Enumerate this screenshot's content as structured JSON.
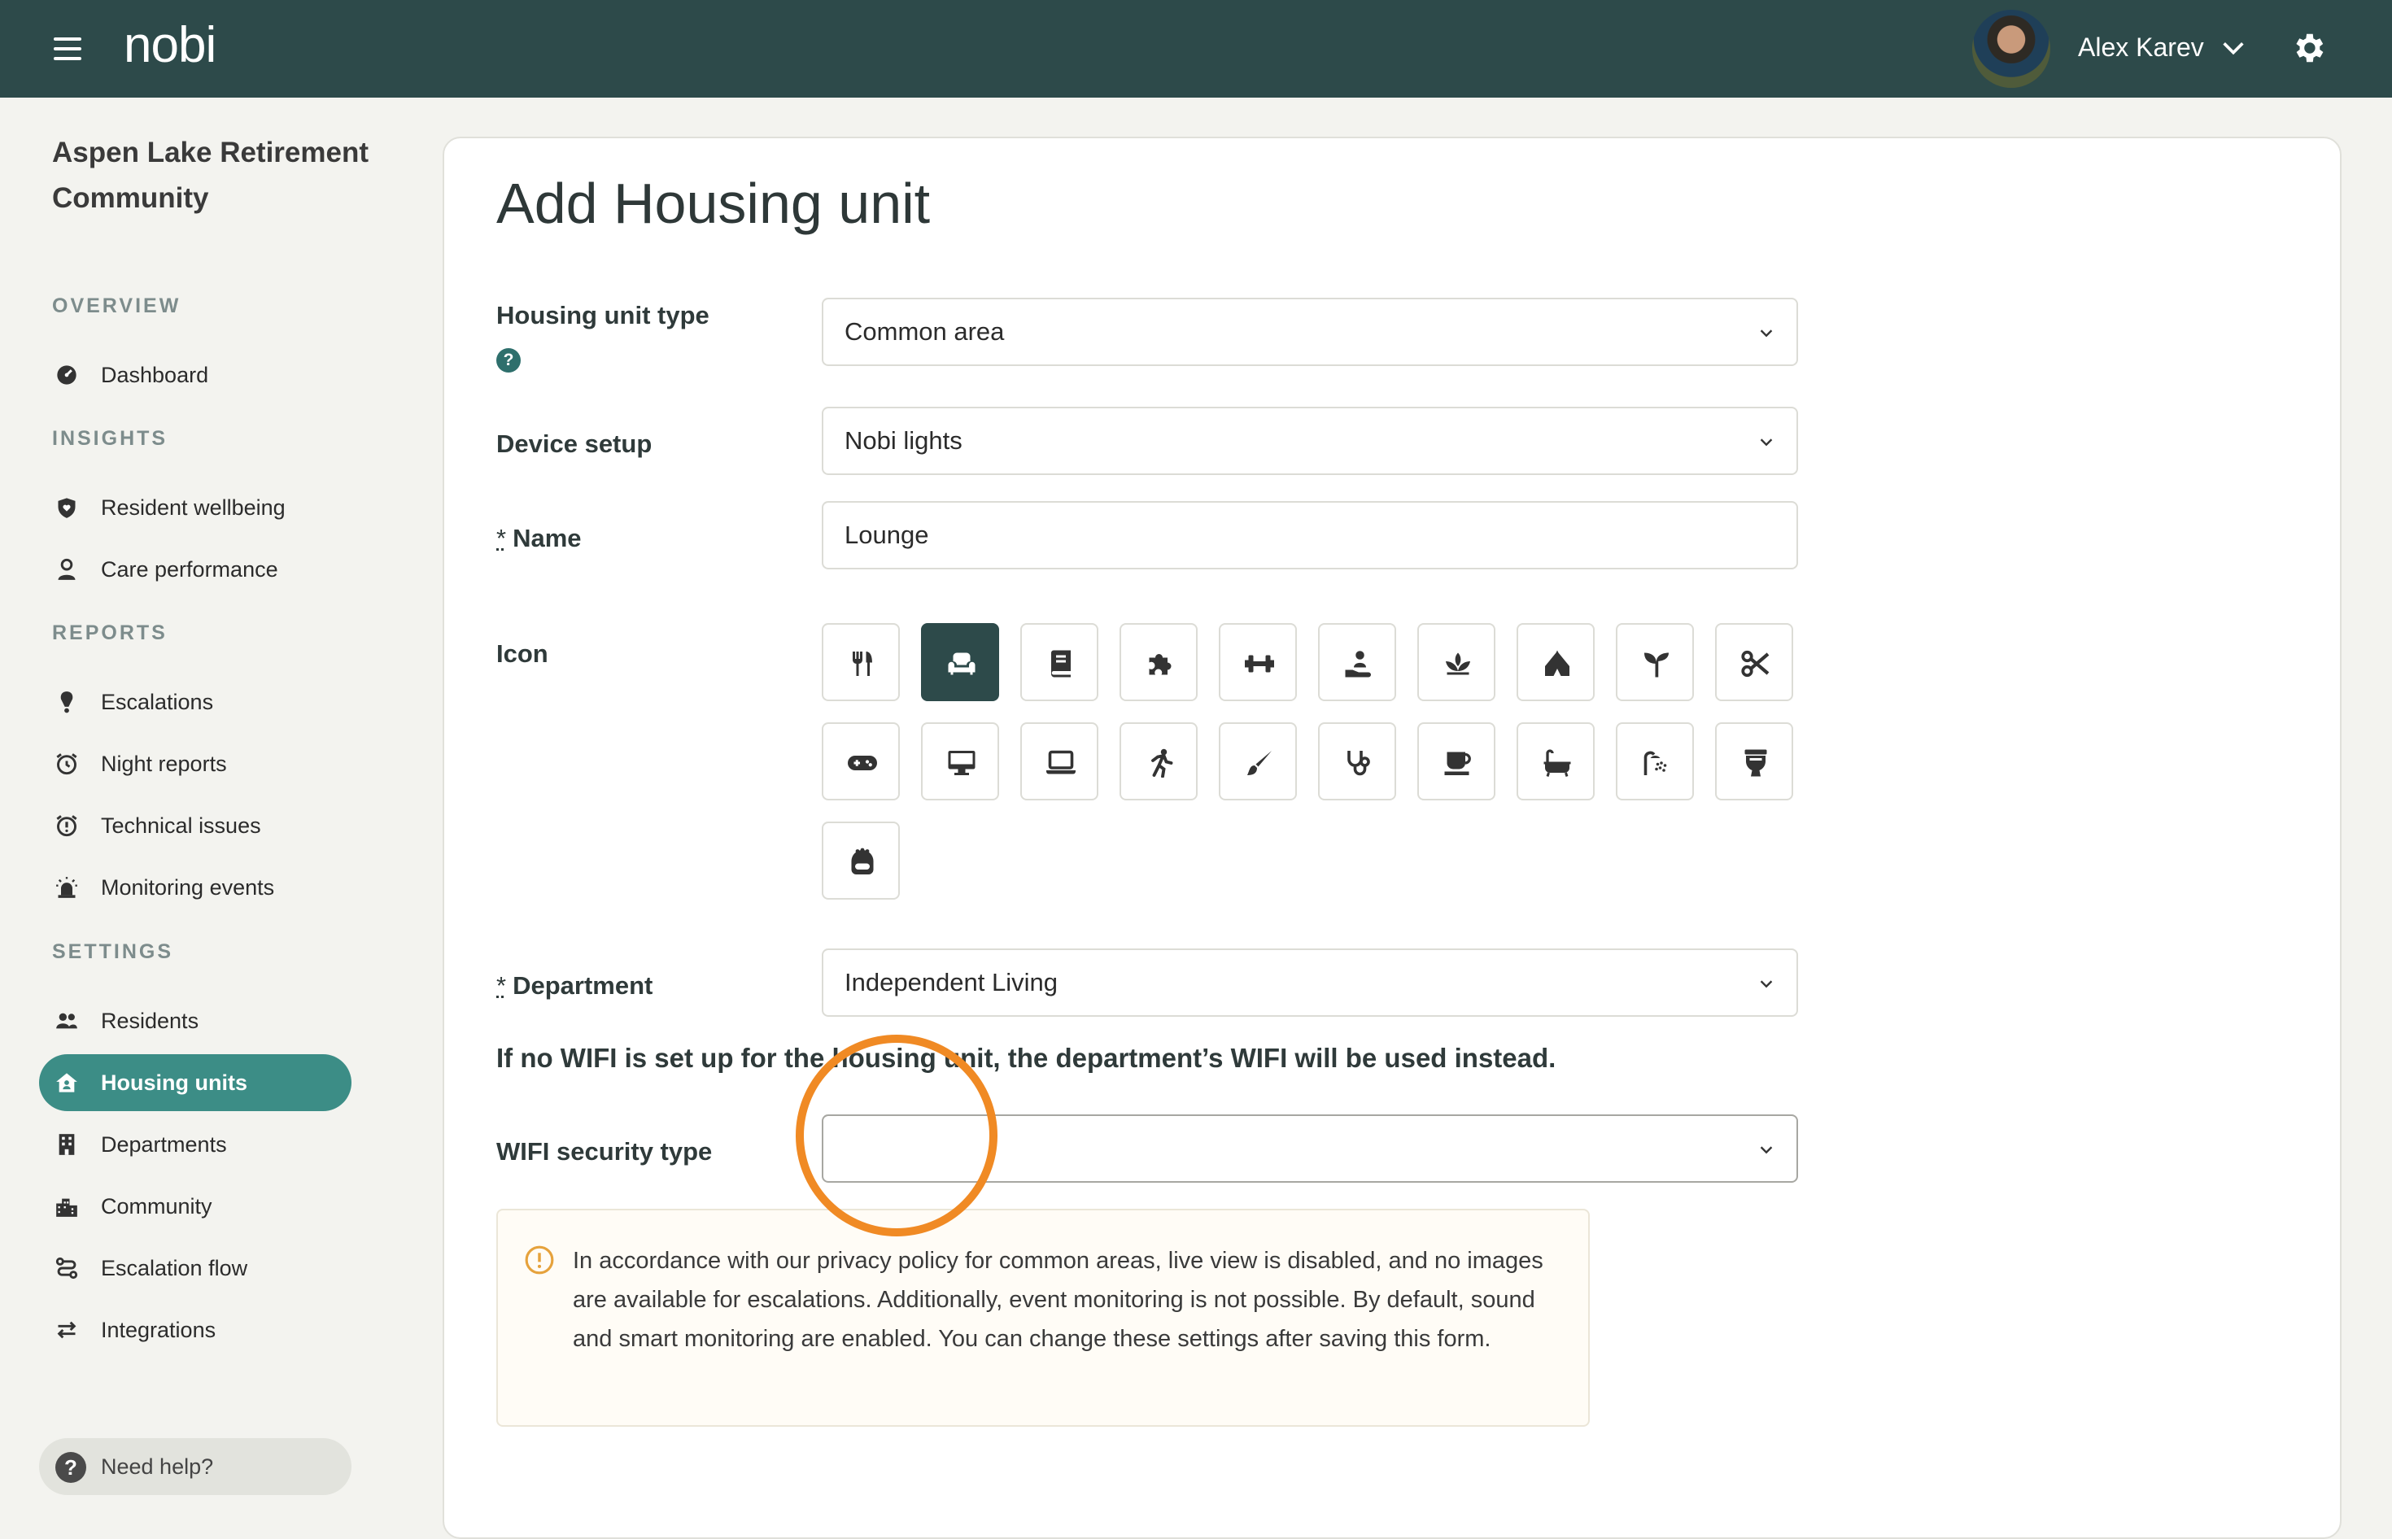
{
  "header": {
    "logo": "nobi",
    "user_name": "Alex Karev"
  },
  "sidebar": {
    "community_name": "Aspen Lake Retirement Community",
    "sections": {
      "overview": "OVERVIEW",
      "insights": "INSIGHTS",
      "reports": "REPORTS",
      "settings": "SETTINGS"
    },
    "items": [
      {
        "label": "Dashboard",
        "icon": "gauge-icon"
      },
      {
        "label": "Resident wellbeing",
        "icon": "shield-heart-icon"
      },
      {
        "label": "Care performance",
        "icon": "person-badge-icon"
      },
      {
        "label": "Escalations",
        "icon": "alert-pin-icon"
      },
      {
        "label": "Night reports",
        "icon": "alarm-clock-icon"
      },
      {
        "label": "Technical issues",
        "icon": "alarm-warning-icon"
      },
      {
        "label": "Monitoring events",
        "icon": "siren-icon"
      },
      {
        "label": "Residents",
        "icon": "people-icon"
      },
      {
        "label": "Housing units",
        "icon": "house-user-icon",
        "active": true
      },
      {
        "label": "Departments",
        "icon": "building-icon"
      },
      {
        "label": "Community",
        "icon": "city-icon"
      },
      {
        "label": "Escalation flow",
        "icon": "route-icon"
      },
      {
        "label": "Integrations",
        "icon": "arrows-exchange-icon"
      }
    ],
    "help_label": "Need help?"
  },
  "form": {
    "title": "Add Housing unit",
    "housing_unit_type": {
      "label": "Housing unit type",
      "value": "Common area"
    },
    "device_setup": {
      "label": "Device setup",
      "value": "Nobi lights"
    },
    "name": {
      "label": "Name",
      "value": "Lounge",
      "required_mark": "*"
    },
    "icon": {
      "label": "Icon",
      "options": [
        "utensils-icon",
        "couch-icon",
        "book-icon",
        "puzzle-icon",
        "dumbbell-icon",
        "hand-holding-person-icon",
        "lotus-icon",
        "tent-icon",
        "seedling-icon",
        "scissors-icon",
        "gamepad-icon",
        "desktop-icon",
        "laptop-icon",
        "running-person-icon",
        "paintbrush-icon",
        "stethoscope-icon",
        "coffee-icon",
        "bathtub-icon",
        "shower-icon",
        "toilet-icon",
        "robot-bath-icon"
      ],
      "selected": "couch-icon"
    },
    "department": {
      "label": "Department",
      "value": "Independent Living",
      "required_mark": "*"
    },
    "wifi_note": "If no WIFI is set up for the housing unit, the department’s WIFI will be used instead.",
    "wifi_security": {
      "label": "WIFI security type",
      "value": ""
    },
    "notice": "In accordance with our privacy policy for common areas, live view is disabled, and no images are available for escalations. Additionally, event monitoring is not possible. By default, sound and smart monitoring are enabled. You can change these settings after saving this form."
  },
  "colors": {
    "topbar": "#2d4a4a",
    "accent": "#3c8d86",
    "highlight": "#f08a24"
  }
}
